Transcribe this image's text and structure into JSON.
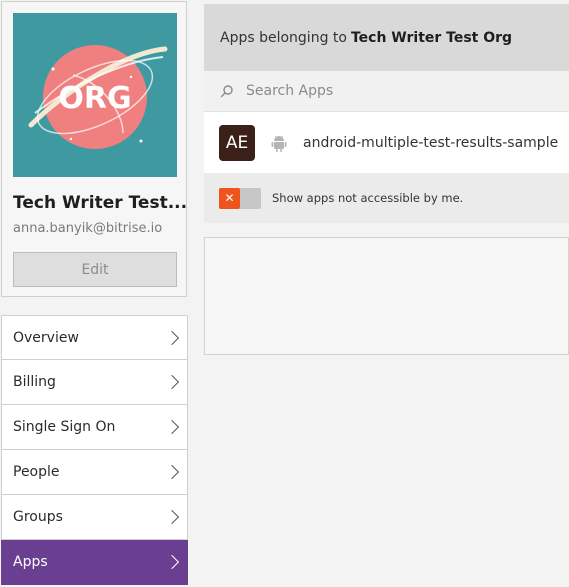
{
  "org": {
    "avatar_text": "ORG",
    "name": "Tech Writer Test...",
    "email": "anna.banyik@bitrise.io",
    "edit_label": "Edit"
  },
  "nav": {
    "items": [
      {
        "label": "Overview"
      },
      {
        "label": "Billing"
      },
      {
        "label": "Single Sign On"
      },
      {
        "label": "People"
      },
      {
        "label": "Groups"
      },
      {
        "label": "Apps"
      }
    ],
    "active": "Apps"
  },
  "apps": {
    "header_prefix": "Apps belonging to",
    "header_org": "Tech Writer Test Org",
    "search_placeholder": "Search Apps",
    "list": [
      {
        "badge": "AE",
        "platform_icon": "android-icon",
        "name": "android-multiple-test-results-sample"
      }
    ],
    "toggle_label": "Show apps not accessible by me.",
    "toggle_on": false
  },
  "colors": {
    "avatar_bg": "#3e9aa0",
    "avatar_circle": "#f08080",
    "nav_active": "#6a3e91",
    "toggle_off_knob": "#f0541e",
    "app_badge": "#3a2019"
  }
}
